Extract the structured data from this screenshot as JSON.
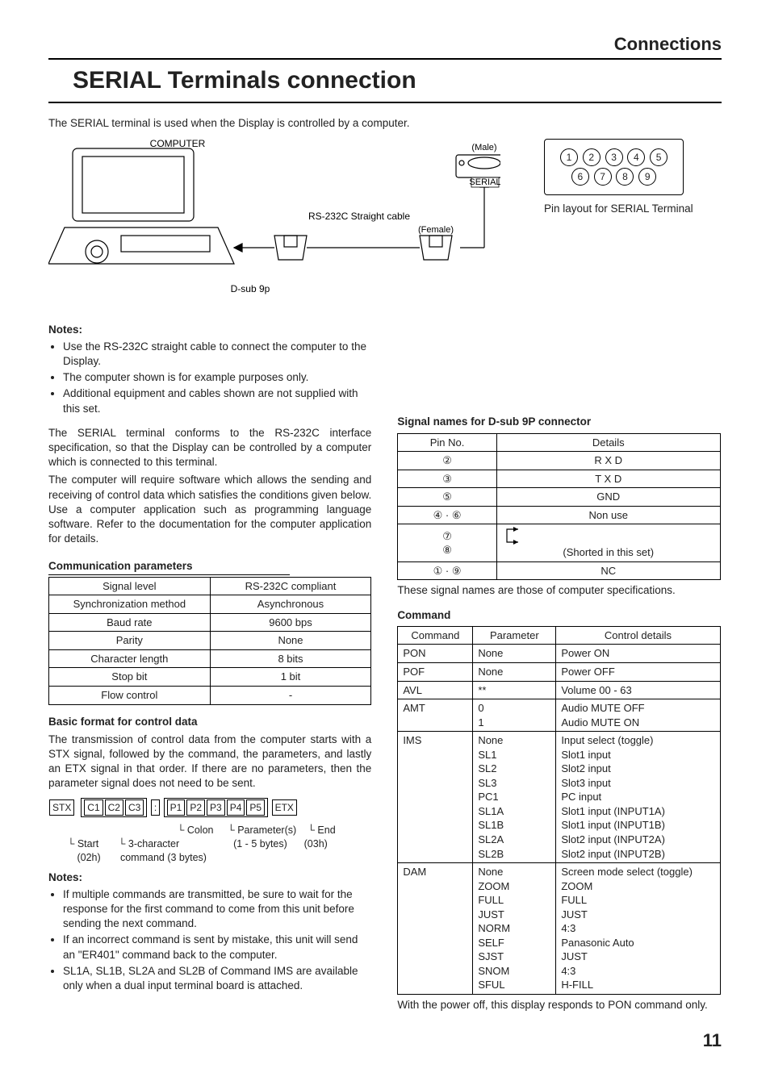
{
  "header": {
    "section": "Connections"
  },
  "title": "SERIAL Terminals connection",
  "intro": "The SERIAL terminal is used when the Display is controlled by a computer.",
  "diagram": {
    "computer": "COMPUTER",
    "dsub": "D-sub 9p",
    "cable": "RS-232C Straight cable",
    "female": "(Female)",
    "male": "(Male)",
    "serial": "SERIAL"
  },
  "pinlayout": {
    "caption": "Pin layout for SERIAL Terminal"
  },
  "notes1_heading": "Notes:",
  "notes1": [
    "Use the RS-232C straight cable to connect the computer to the Display.",
    "The computer shown is for example purposes only.",
    "Additional equipment and cables shown are not supplied with this set."
  ],
  "para1": "The SERIAL terminal conforms to the RS-232C interface specification, so that the Display can be controlled by a computer which is connected to this terminal.",
  "para2": "The computer will require software which allows the sending and receiving of control data which satisfies the conditions given below. Use a computer application such as programming language software. Refer to the documentation for the computer application for details.",
  "comm_heading": "Communication parameters",
  "comm_params": [
    [
      "Signal level",
      "RS-232C compliant"
    ],
    [
      "Synchronization method",
      "Asynchronous"
    ],
    [
      "Baud rate",
      "9600 bps"
    ],
    [
      "Parity",
      "None"
    ],
    [
      "Character length",
      "8 bits"
    ],
    [
      "Stop bit",
      "1 bit"
    ],
    [
      "Flow control",
      "-"
    ]
  ],
  "format_heading": "Basic format for control data",
  "format_text": "The transmission of control data from the computer starts with a STX signal, followed by the command, the parameters, and lastly an ETX signal in that order. If there are no parameters, then the parameter signal does not need to be sent.",
  "format_boxes": {
    "stx": "STX",
    "c1": "C1",
    "c2": "C2",
    "c3": "C3",
    "colon": ":",
    "p1": "P1",
    "p2": "P2",
    "p3": "P3",
    "p4": "P4",
    "p5": "P5",
    "etx": "ETX"
  },
  "format_labels": {
    "start": "Start",
    "start_hex": "(02h)",
    "cmd": "3-character",
    "cmd2": "command (3 bytes)",
    "colon": "Colon",
    "param": "Parameter(s)",
    "param2": "(1 - 5 bytes)",
    "end": "End",
    "end_hex": "(03h)"
  },
  "notes2_heading": "Notes:",
  "notes2": [
    "If multiple commands are transmitted, be sure to wait for the response for the first command to come from this unit before sending the next command.",
    "If an incorrect command is sent by mistake, this unit will send an \"ER401\" command back to the computer.",
    "SL1A, SL1B, SL2A and SL2B of Command IMS are available only when a dual input terminal board is attached."
  ],
  "sig_heading": "Signal names for D-sub 9P connector",
  "sig_headers": [
    "Pin No.",
    "Details"
  ],
  "sig_rows": [
    {
      "pin": "②",
      "detail": "R X D"
    },
    {
      "pin": "③",
      "detail": "T X D"
    },
    {
      "pin": "⑤",
      "detail": "GND"
    },
    {
      "pin": "④ · ⑥",
      "detail": "Non use"
    },
    {
      "pin": "⑦\n⑧",
      "detail": "(Shorted in this set)",
      "shorted": true
    },
    {
      "pin": "① · ⑨",
      "detail": "NC"
    }
  ],
  "sig_footer": "These signal names are those of computer specifications.",
  "cmd_heading": "Command",
  "cmd_headers": [
    "Command",
    "Parameter",
    "Control details"
  ],
  "cmd_rows": [
    {
      "c": "PON",
      "p": "None",
      "d": "Power ON"
    },
    {
      "c": "POF",
      "p": "None",
      "d": "Power OFF"
    },
    {
      "c": "AVL",
      "p": "**",
      "d": "Volume 00 - 63"
    },
    {
      "c": "AMT",
      "p": "0\n1",
      "d": "Audio MUTE OFF\nAudio MUTE ON"
    },
    {
      "c": "IMS",
      "p": "None\nSL1\nSL2\nSL3\nPC1\nSL1A\nSL1B\nSL2A\nSL2B",
      "d": "Input select (toggle)\nSlot1 input\nSlot2 input\nSlot3 input\nPC input\nSlot1 input (INPUT1A)\nSlot1 input (INPUT1B)\nSlot2 input (INPUT2A)\nSlot2 input (INPUT2B)"
    },
    {
      "c": "DAM",
      "p": "None\nZOOM\nFULL\nJUST\nNORM\nSELF\nSJST\nSNOM\nSFUL",
      "d": "Screen mode select (toggle)\nZOOM\nFULL\nJUST\n4:3\nPanasonic Auto\nJUST\n4:3\nH-FILL"
    }
  ],
  "cmd_footer": "With the power off, this display responds to PON command only.",
  "page_number": "11"
}
